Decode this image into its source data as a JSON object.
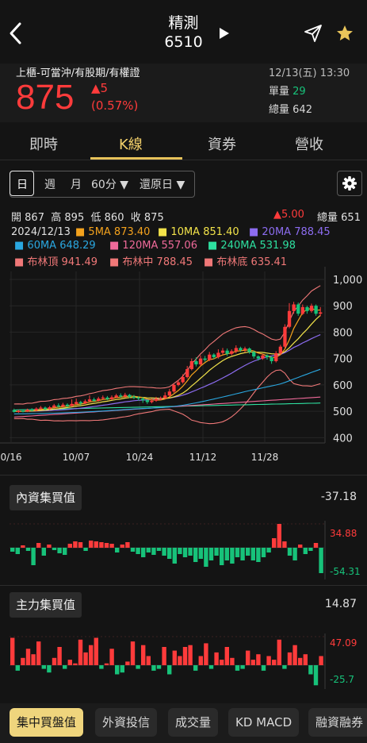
{
  "header": {
    "name": "精測",
    "code": "6510"
  },
  "quote": {
    "tags": "上櫃-可當沖/有股期/有權證",
    "price": "875",
    "change": "▲5",
    "change_pct": "(0.57%)",
    "datetime": "12/13(五) 13:30",
    "single_label": "單量",
    "single_value": "29",
    "total_label": "總量",
    "total_value": "642"
  },
  "tabs": [
    "即時",
    "K線",
    "資券",
    "營收"
  ],
  "periods": {
    "day": "日",
    "week": "週",
    "month": "月",
    "minute": "60分 ▼",
    "adjust": "還原日 ▼"
  },
  "ohlc": {
    "open_label": "開",
    "open": "867",
    "high_label": "高",
    "high": "895",
    "low_label": "低",
    "low": "860",
    "close_label": "收",
    "close": "875",
    "change": "▲5.00",
    "volume_label": "總量",
    "volume": "651"
  },
  "legend": {
    "date": "2024/12/13",
    "ma5": "5MA 873.40",
    "ma10": "10MA 851.40",
    "ma20": "20MA 788.45",
    "ma60": "60MA 648.29",
    "ma120": "120MA 557.06",
    "ma240": "240MA 531.98",
    "boll_up": "布林頂 941.49",
    "boll_mid": "布林中 788.45",
    "boll_low": "布林底 635.41"
  },
  "colors": {
    "up": "#ff3b3b",
    "down": "#17c27a",
    "ma5": "#f4a21d",
    "ma10": "#f2e34a",
    "ma20": "#8c6cf0",
    "ma60": "#2aa7e0",
    "ma120": "#f06a9a",
    "ma240": "#2ee0a0",
    "boll": "#f07878",
    "accent": "#efd57d"
  },
  "chart_data": [
    {
      "type": "candlestick",
      "yticks": [
        "1,000",
        "900",
        "800",
        "700",
        "600",
        "500",
        "400"
      ],
      "ylim": [
        380,
        1030
      ],
      "xticks": [
        "0/16",
        "10/07",
        "10/24",
        "11/12",
        "11/28"
      ],
      "candles": [
        [
          505,
          498,
          510,
          495
        ],
        [
          498,
          502,
          506,
          494
        ],
        [
          502,
          500,
          508,
          496
        ],
        [
          500,
          506,
          510,
          497
        ],
        [
          506,
          503,
          512,
          500
        ],
        [
          503,
          510,
          515,
          500
        ],
        [
          510,
          514,
          520,
          506
        ],
        [
          514,
          508,
          518,
          504
        ],
        [
          508,
          515,
          520,
          505
        ],
        [
          515,
          522,
          528,
          510
        ],
        [
          522,
          518,
          530,
          514
        ],
        [
          518,
          525,
          532,
          515
        ],
        [
          525,
          520,
          530,
          516
        ],
        [
          520,
          528,
          545,
          518
        ],
        [
          528,
          535,
          548,
          525
        ],
        [
          535,
          530,
          540,
          522
        ],
        [
          530,
          538,
          545,
          528
        ],
        [
          538,
          545,
          560,
          535
        ],
        [
          545,
          540,
          552,
          536
        ],
        [
          540,
          548,
          555,
          537
        ],
        [
          548,
          552,
          560,
          544
        ],
        [
          552,
          546,
          558,
          542
        ],
        [
          546,
          553,
          560,
          543
        ],
        [
          553,
          560,
          566,
          550
        ],
        [
          560,
          556,
          568,
          551
        ],
        [
          556,
          562,
          570,
          552
        ],
        [
          562,
          555,
          566,
          550
        ],
        [
          555,
          552,
          562,
          546
        ],
        [
          552,
          548,
          556,
          540
        ],
        [
          548,
          542,
          554,
          532
        ],
        [
          542,
          535,
          546,
          528
        ],
        [
          535,
          540,
          548,
          530
        ],
        [
          540,
          547,
          555,
          536
        ],
        [
          547,
          550,
          556,
          542
        ],
        [
          550,
          560,
          572,
          546
        ],
        [
          560,
          575,
          585,
          555
        ],
        [
          575,
          600,
          605,
          570
        ],
        [
          600,
          610,
          618,
          595
        ],
        [
          610,
          630,
          640,
          605
        ],
        [
          630,
          660,
          672,
          625
        ],
        [
          660,
          690,
          700,
          655
        ],
        [
          690,
          678,
          705,
          670
        ],
        [
          678,
          700,
          712,
          672
        ],
        [
          700,
          695,
          710,
          688
        ],
        [
          695,
          715,
          725,
          690
        ],
        [
          715,
          705,
          720,
          698
        ],
        [
          705,
          722,
          735,
          700
        ],
        [
          722,
          730,
          740,
          715
        ],
        [
          730,
          718,
          738,
          710
        ],
        [
          718,
          728,
          735,
          712
        ],
        [
          728,
          740,
          750,
          720
        ],
        [
          740,
          732,
          745,
          725
        ],
        [
          732,
          738,
          745,
          724
        ],
        [
          738,
          725,
          742,
          718
        ],
        [
          725,
          708,
          730,
          700
        ],
        [
          708,
          700,
          712,
          692
        ],
        [
          700,
          712,
          718,
          695
        ],
        [
          712,
          705,
          716,
          696
        ],
        [
          705,
          690,
          710,
          680
        ],
        [
          690,
          720,
          728,
          685
        ],
        [
          720,
          745,
          752,
          715
        ],
        [
          745,
          820,
          830,
          740
        ],
        [
          820,
          880,
          910,
          815
        ],
        [
          880,
          905,
          915,
          870
        ],
        [
          905,
          870,
          912,
          862
        ],
        [
          870,
          895,
          905,
          865
        ],
        [
          895,
          880,
          900,
          870
        ],
        [
          880,
          900,
          908,
          874
        ],
        [
          900,
          870,
          905,
          862
        ],
        [
          870,
          875,
          895,
          860
        ]
      ]
    },
    {
      "type": "bar",
      "title": "內資集買值",
      "value": "-37.18",
      "ylabels": [
        "34.88",
        "-54.31"
      ],
      "values": [
        -5,
        -8,
        3,
        -4,
        -22,
        6,
        -10,
        4,
        -3,
        -7,
        -9,
        5,
        8,
        7,
        -4,
        9,
        8,
        7,
        6,
        5,
        -6,
        4,
        7,
        -5,
        -8,
        -12,
        -6,
        -9,
        -4,
        -10,
        -14,
        -20,
        -8,
        -12,
        -10,
        -18,
        -14,
        -24,
        -16,
        -10,
        -22,
        -16,
        -20,
        -12,
        -16,
        -10,
        -16,
        -18,
        -12,
        -6,
        12,
        30,
        8,
        -10,
        -16,
        4,
        -8,
        -4,
        6,
        -32
      ]
    },
    {
      "type": "bar",
      "title": "主力集買值",
      "value": "14.87",
      "ylabels": [
        "47.09",
        "-25.7"
      ],
      "values": [
        30,
        -6,
        8,
        18,
        12,
        26,
        -4,
        -8,
        8,
        20,
        -4,
        6,
        2,
        28,
        14,
        22,
        30,
        -4,
        2,
        18,
        -10,
        -8,
        4,
        26,
        -4,
        22,
        10,
        -6,
        -4,
        20,
        -10,
        16,
        10,
        20,
        22,
        -6,
        10,
        24,
        -4,
        14,
        6,
        20,
        8,
        -6,
        -4,
        16,
        6,
        12,
        -6,
        10,
        6,
        28,
        -4,
        14,
        22,
        8,
        12,
        -10,
        -22,
        10
      ]
    }
  ],
  "panels": {
    "main_force": {
      "label": "主力集買值",
      "value": "14.87"
    },
    "domestic": {
      "label": "內資集買值",
      "value": "-37.18"
    }
  },
  "bottom_tabs": [
    "集中買盤值",
    "外資投信",
    "成交量",
    "KD MACD",
    "融資融券"
  ]
}
